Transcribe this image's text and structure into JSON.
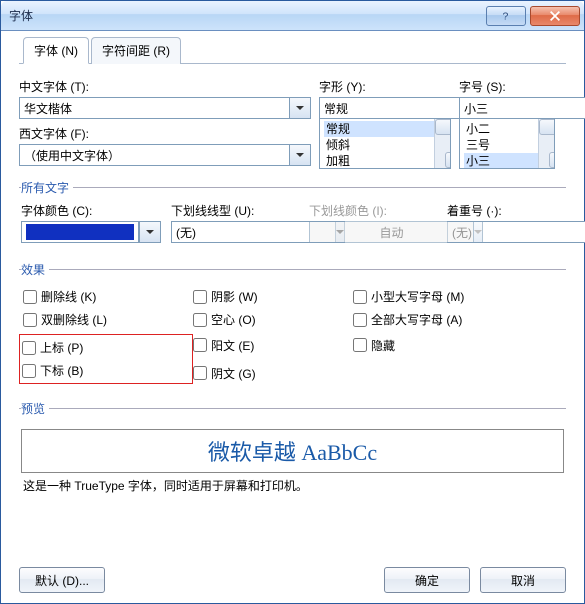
{
  "window": {
    "title": "字体"
  },
  "tabs": {
    "font": "字体 (N)",
    "spacing": "字符间距 (R)"
  },
  "labels": {
    "cnFont": "中文字体 (T):",
    "westFont": "西文字体 (F):",
    "style": "字形 (Y):",
    "size": "字号 (S):",
    "fontColor": "字体颜色 (C):",
    "underlineStyle": "下划线线型 (U):",
    "underlineColor": "下划线颜色 (I):",
    "emphasis": "着重号 (·):"
  },
  "values": {
    "cnFont": "华文楷体",
    "westFont": "（使用中文字体）",
    "style": "常规",
    "size": "小三",
    "underlineStyle": "(无)",
    "underlineColor": "自动",
    "emphasis": "(无)",
    "fontColorHex": "#1030c0"
  },
  "styleList": [
    "常规",
    "倾斜",
    "加粗"
  ],
  "sizeList": [
    "小二",
    "三号",
    "小三"
  ],
  "groups": {
    "allText": "所有文字",
    "effects": "效果",
    "preview": "预览"
  },
  "effects": {
    "strike": "删除线 (K)",
    "dstrike": "双删除线 (L)",
    "superscript": "上标 (P)",
    "subscript": "下标 (B)",
    "shadow": "阴影 (W)",
    "outline": "空心 (O)",
    "emboss": "阳文 (E)",
    "engrave": "阴文 (G)",
    "smallcaps": "小型大写字母 (M)",
    "allcaps": "全部大写字母 (A)",
    "hidden": "隐藏"
  },
  "preview": {
    "text": "微软卓越 AaBbCc"
  },
  "description": "这是一种 TrueType 字体，同时适用于屏幕和打印机。",
  "buttons": {
    "default": "默认 (D)...",
    "ok": "确定",
    "cancel": "取消"
  }
}
